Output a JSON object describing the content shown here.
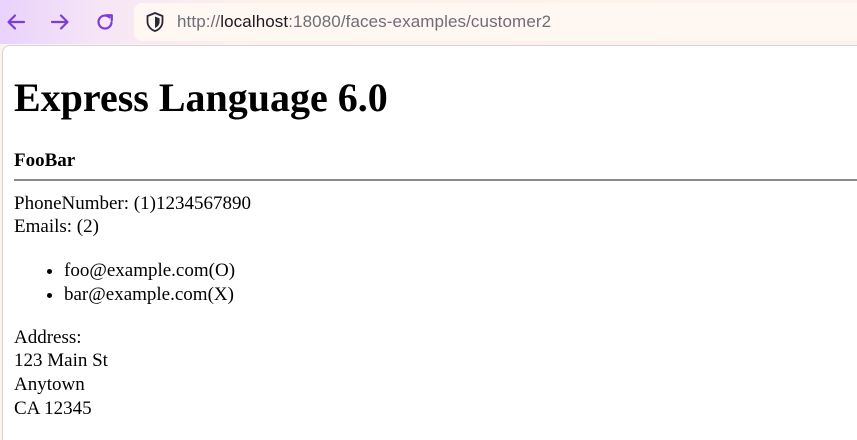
{
  "browser": {
    "url_prefix": "http://",
    "url_host": "localhost",
    "url_rest": ":18080/faces-examples/customer2",
    "back_icon": "arrow-left-icon",
    "forward_icon": "arrow-right-icon",
    "reload_icon": "reload-icon",
    "security_icon": "shield-icon",
    "accent_color": "#7b3fd8"
  },
  "page": {
    "title": "Express Language 6.0",
    "customer_name": "FooBar",
    "phone": "PhoneNumber: (1)1234567890",
    "emails_label": "Emails: (2)",
    "emails": [
      "foo@example.com(O)",
      "bar@example.com(X)"
    ],
    "address_label": "Address:",
    "address_lines": [
      "123 Main St",
      "Anytown",
      "CA 12345"
    ]
  }
}
